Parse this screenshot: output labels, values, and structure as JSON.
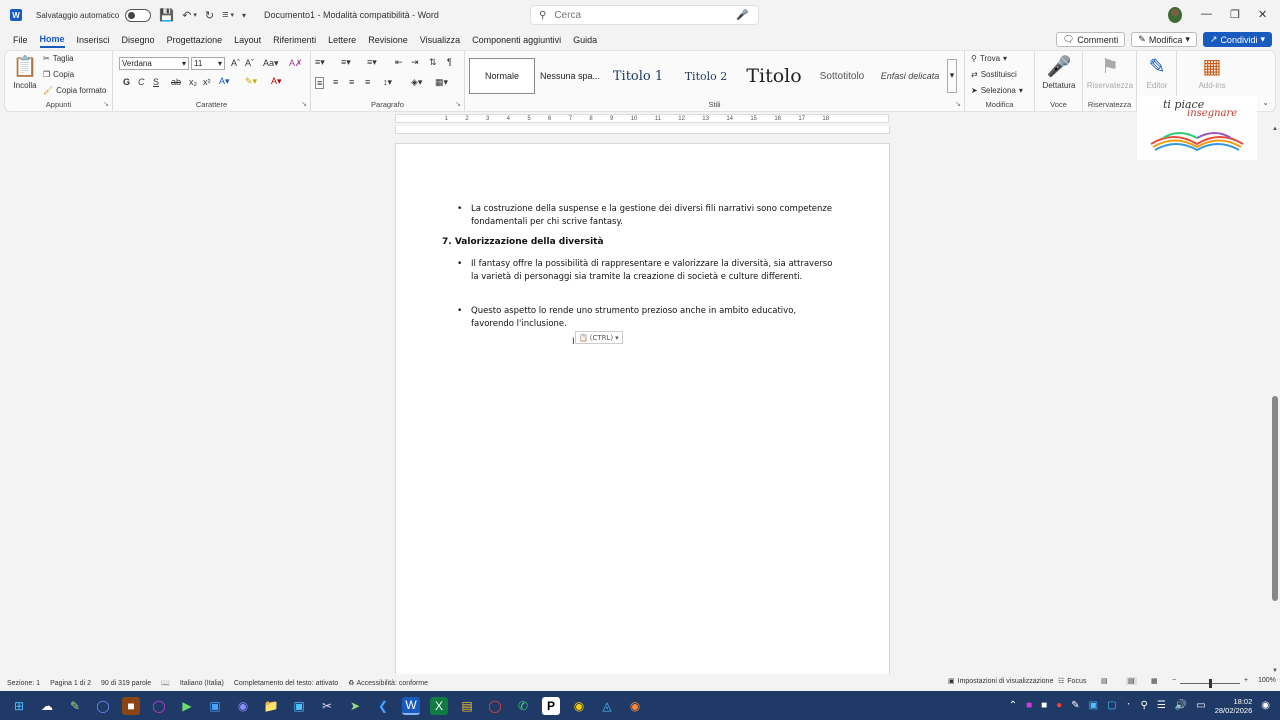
{
  "titlebar": {
    "autosave_label": "Salvataggio automatico",
    "document_title": "Documento1  -  Modalità compatibilità  -  Word",
    "search_placeholder": "Cerca"
  },
  "menu": {
    "tabs": [
      "File",
      "Home",
      "Inserisci",
      "Disegno",
      "Progettazione",
      "Layout",
      "Riferimenti",
      "Lettere",
      "Revisione",
      "Visualizza",
      "Componenti aggiuntivi",
      "Guida"
    ],
    "active": "Home",
    "comments_label": "Commenti",
    "edit_label": "Modifica",
    "share_label": "Condividi"
  },
  "ribbon": {
    "clipboard": {
      "paste": "Incolla",
      "cut": "Taglia",
      "copy": "Copia",
      "format_painter": "Copia formato",
      "label": "Appunti"
    },
    "font": {
      "family": "Verdana",
      "size": "11",
      "bold": "G",
      "italic": "C",
      "underline": "S",
      "label": "Carattere"
    },
    "paragraph": {
      "label": "Paragrafo"
    },
    "styles": {
      "items": [
        "Normale",
        "Nessuna spa...",
        "Titolo 1",
        "Titolo 2",
        "Titolo",
        "Sottotitolo",
        "Enfasi delicata"
      ],
      "label": "Stili"
    },
    "editing": {
      "find": "Trova",
      "replace": "Sostituisci",
      "select": "Seleziona",
      "label": "Modifica"
    },
    "voice": {
      "dictate": "Dettatura",
      "label": "Voce"
    },
    "sensitivity": {
      "label": "Riservatezza"
    },
    "editor": {
      "label": "Editor"
    },
    "addins": {
      "label": "Add-ins",
      "group_label": "Componenti aggiuntivi"
    }
  },
  "ruler": {
    "ticks": [
      "1",
      "2",
      "1",
      "1",
      "2",
      "3",
      "4",
      "5",
      "6",
      "7",
      "8",
      "9",
      "10",
      "11",
      "12",
      "13",
      "14",
      "15",
      "16",
      "17",
      "18"
    ]
  },
  "document": {
    "bullet1": "La costruzione della suspense e la gestione dei diversi fili narrativi sono competenze fondamentali per chi scrive fantasy.",
    "heading7": "7. Valorizzazione della diversità",
    "bullet2": "Il fantasy offre la possibilità di rappresentare e valorizzare la diversità, sia attraverso la varietà di personaggi sia tramite la creazione di società e culture differenti.",
    "bullet3": "Questo aspetto lo rende uno strumento prezioso anche in ambito educativo, favorendo l'inclusione.",
    "paste_options": "(CTRL)"
  },
  "logo": {
    "line1": "ti piace",
    "line2": "insegnare"
  },
  "status": {
    "section": "Sezione: 1",
    "page": "Pagina 1 di 2",
    "words": "90 di 319 parole",
    "language": "Italiano (Italia)",
    "autocomplete": "Completamento del testo: attivato",
    "accessibility": "Accessibilità: conforme",
    "display_settings": "Impostazioni di visualizzazione",
    "focus": "Focus",
    "zoom": "100%"
  },
  "taskbar": {
    "time": "18:02",
    "date": "28/02/2026"
  },
  "colors": {
    "accent": "#185abd",
    "taskbar": "#1f3a66",
    "save_icon": "#a13fa3"
  }
}
